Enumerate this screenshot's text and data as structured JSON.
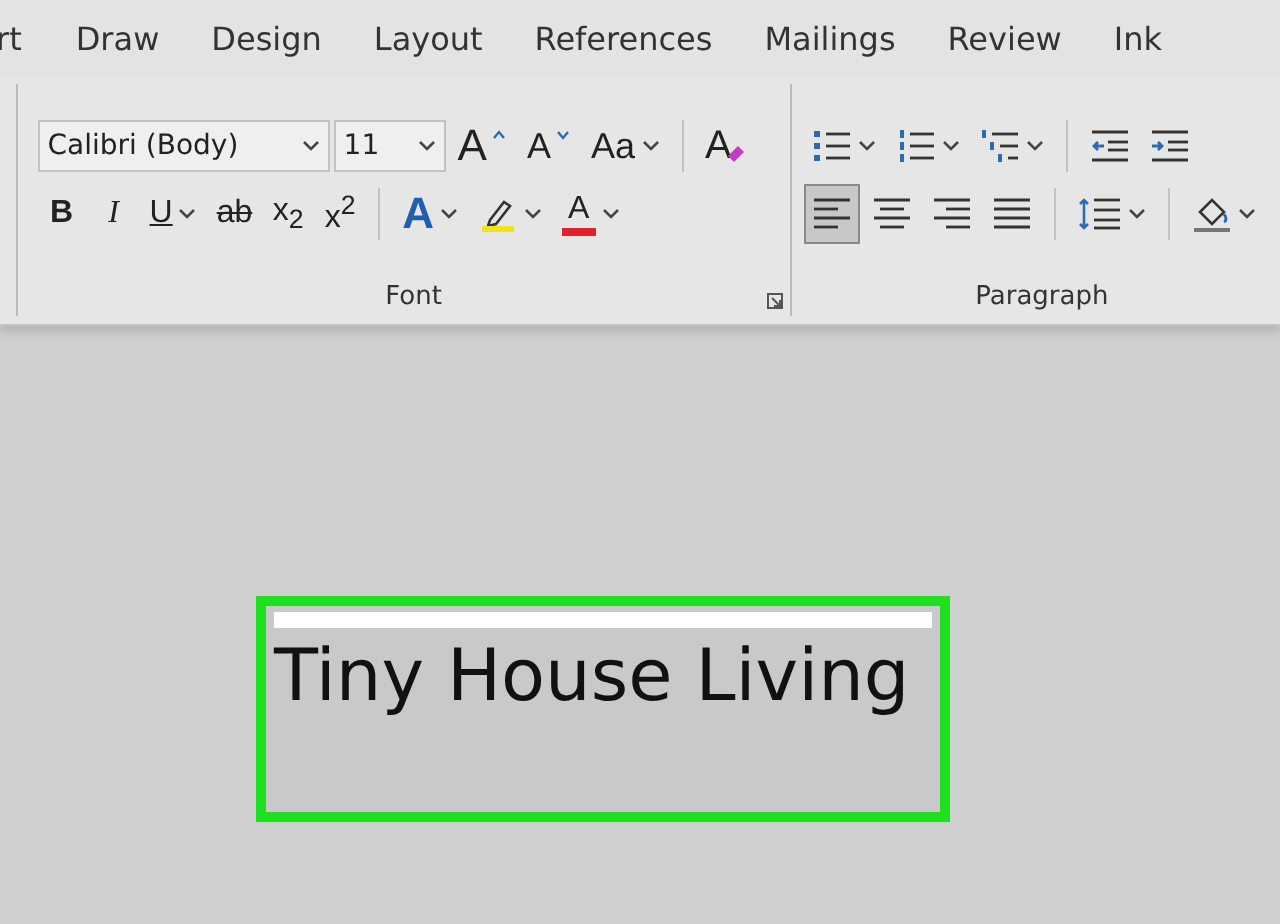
{
  "tabs": [
    {
      "label": "rt",
      "selected": false
    },
    {
      "label": "Draw",
      "selected": false
    },
    {
      "label": "Design",
      "selected": false
    },
    {
      "label": "Layout",
      "selected": false
    },
    {
      "label": "References",
      "selected": false
    },
    {
      "label": "Mailings",
      "selected": false
    },
    {
      "label": "Review",
      "selected": false
    },
    {
      "label": "Ink",
      "selected": false
    }
  ],
  "font_group": {
    "label": "Font",
    "font_name": "Calibri (Body)",
    "font_size": "11",
    "row1": [
      {
        "kind": "grow",
        "text": "A"
      },
      {
        "kind": "shrink",
        "text": "A"
      },
      {
        "kind": "case",
        "text": "Aa",
        "dropdown": true
      },
      {
        "kind": "clear",
        "text": "A"
      }
    ],
    "row2": [
      {
        "kind": "bold",
        "text": "B"
      },
      {
        "kind": "italic",
        "text": "I"
      },
      {
        "kind": "underline",
        "text": "U",
        "dropdown": true
      },
      {
        "kind": "strike",
        "text": "ab"
      },
      {
        "kind": "script",
        "text": "x$_{2}$"
      },
      {
        "kind": "script",
        "text": "x$^{2}$"
      },
      {
        "kind": "effects",
        "text": "A",
        "dropdown": true
      },
      {
        "kind": "highlight",
        "color": "#f2e21a",
        "dropdown": true
      },
      {
        "kind": "fontcolor",
        "text": "A",
        "color": "#e0202a",
        "dropdown": true
      }
    ]
  },
  "paragraph_group": {
    "label": "Paragraph",
    "row1": [
      {
        "kind": "bullets",
        "dropdown": true
      },
      {
        "kind": "numbering",
        "dropdown": true
      },
      {
        "kind": "multilevel",
        "dropdown": true
      },
      {
        "kind": "outdent"
      },
      {
        "kind": "indent"
      }
    ],
    "row2": [
      {
        "kind": "align-left",
        "selected": true
      },
      {
        "kind": "align-center",
        "selected": false
      },
      {
        "kind": "align-right",
        "selected": false
      },
      {
        "kind": "justify",
        "selected": false
      },
      {
        "kind": "spacing",
        "dropdown": true
      },
      {
        "kind": "shading",
        "dropdown": true
      }
    ]
  },
  "document": {
    "heading": "Tiny House Living"
  }
}
